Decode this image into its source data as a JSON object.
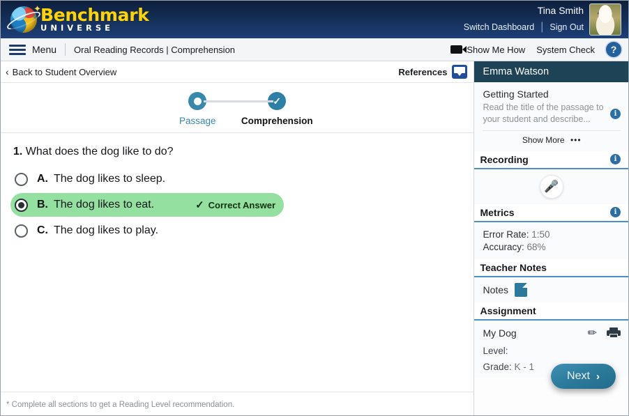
{
  "brand": {
    "name_primary": "Benchmark",
    "name_secondary": "UNIVERSE",
    "logo_icon": "planet-logo"
  },
  "account": {
    "user_name": "Tina Smith",
    "switch_dashboard_label": "Switch Dashboard",
    "sign_out_label": "Sign Out",
    "avatar_icon": "dog-avatar"
  },
  "toolbar": {
    "menu_label": "Menu",
    "menu_icon": "hamburger-icon",
    "breadcrumb": "Oral Reading Records | Comprehension",
    "show_me_how_label": "Show Me How",
    "show_me_how_icon": "video-camera-icon",
    "system_check_label": "System Check",
    "help_icon": "question-mark-icon"
  },
  "subheader": {
    "back_label": "Back to Student Overview",
    "back_icon": "chevron-left-icon",
    "references_label": "References",
    "references_icon": "references-card-icon"
  },
  "stepper": {
    "steps": [
      {
        "label": "Passage",
        "state": "current",
        "icon": "ring-dot-icon"
      },
      {
        "label": "Comprehension",
        "state": "done",
        "icon": "check-circle-icon"
      }
    ]
  },
  "question": {
    "number": "1.",
    "prompt": "What does the dog like to do?",
    "options": [
      {
        "letter": "A.",
        "text": "The dog likes to sleep.",
        "selected": false,
        "correct": false
      },
      {
        "letter": "B.",
        "text": "The dog likes to eat.",
        "selected": true,
        "correct": true
      },
      {
        "letter": "C.",
        "text": "The dog likes to play.",
        "selected": false,
        "correct": false
      }
    ],
    "correct_badge_label": "Correct Answer",
    "correct_badge_icon": "check-icon"
  },
  "footnote": "* Complete all sections to get a Reading Level recommendation.",
  "sidebar": {
    "student_name": "Emma Watson",
    "getting_started": {
      "title": "Getting Started",
      "description": "Read the title of the passage to your student and describe...",
      "show_more_label": "Show More",
      "show_more_icon": "ellipsis-icon",
      "info_icon": "info-icon"
    },
    "recording": {
      "title": "Recording",
      "info_icon": "info-icon",
      "mic_icon": "microphone-icon"
    },
    "metrics": {
      "title": "Metrics",
      "info_icon": "info-icon",
      "rows": [
        {
          "label": "Error Rate:",
          "value": "1:50"
        },
        {
          "label": "Accuracy:",
          "value": "68%"
        }
      ]
    },
    "teacher_notes": {
      "title": "Teacher Notes",
      "notes_label": "Notes",
      "notes_icon": "note-page-icon"
    },
    "assignment": {
      "title": "Assignment",
      "name": "My Dog",
      "edit_icon": "pencil-icon",
      "print_icon": "printer-icon",
      "level_label": "Level:",
      "level_value": "",
      "grade_label": "Grade:",
      "grade_value": "K - 1"
    },
    "next_button": {
      "label": "Next",
      "icon": "chevron-right-icon"
    }
  },
  "colors": {
    "brand_navy": "#16305a",
    "accent_blue": "#2b6ea8",
    "teal": "#2d7c9d",
    "correct_green": "#93e0a0",
    "logo_yellow": "#ffd400"
  }
}
